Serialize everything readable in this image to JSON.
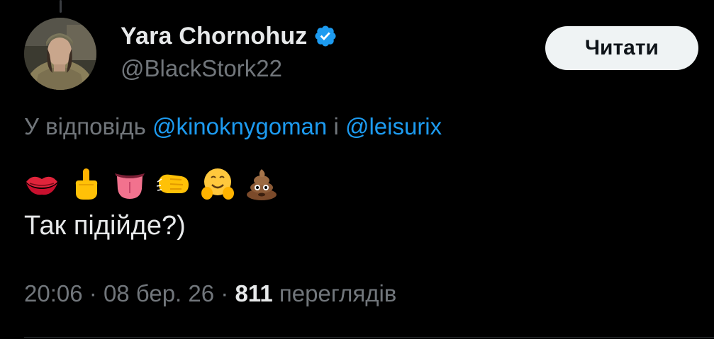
{
  "author": {
    "display_name": "Yara Chornohuz",
    "handle": "@BlackStork22",
    "verified": true
  },
  "follow_button": {
    "label": "Читати"
  },
  "reply_context": {
    "prefix": "У відповідь",
    "mention_1": "@kinoknygoman",
    "conjunction": "і",
    "mention_2": "@leisurix"
  },
  "tweet": {
    "emojis": [
      "kiss-lips-icon",
      "middle-finger-icon",
      "tongue-icon",
      "fist-bump-icon",
      "hugging-face-icon",
      "pile-of-poo-icon"
    ],
    "text": "Так підійде?)"
  },
  "meta": {
    "time": "20:06",
    "separator": "·",
    "date": "08 бер. 26",
    "views_count": "811",
    "views_label": "переглядів"
  },
  "colors": {
    "background": "#000000",
    "primary_text": "#e7e9ea",
    "secondary_text": "#71767b",
    "link": "#1d9bf0",
    "button_bg": "#eff3f4",
    "verified": "#1d9bf0"
  }
}
